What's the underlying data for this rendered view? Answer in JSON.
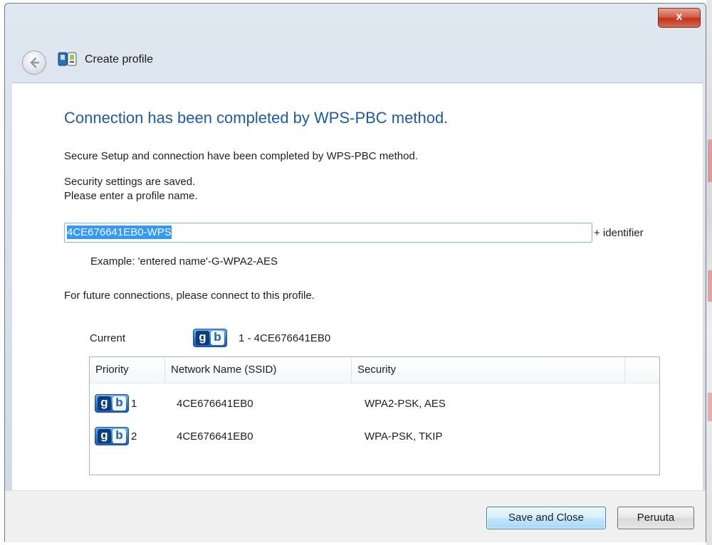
{
  "window": {
    "title": "Create profile",
    "close_label": "x"
  },
  "content": {
    "headline": "Connection has been completed by WPS-PBC method.",
    "line1": "Secure Setup and connection have been completed by WPS-PBC method.",
    "line2": "Security settings are saved.",
    "line3": "Please enter a profile name.",
    "profile_name_value": "4CE676641EB0-WPS",
    "profile_suffix": "+ identifier",
    "example": "Example: 'entered name'-G-WPA2-AES",
    "future_note": "For future connections, please connect to this profile."
  },
  "current": {
    "label": "Current",
    "value": "1 - 4CE676641EB0"
  },
  "table": {
    "headers": [
      "Priority",
      "Network Name (SSID)",
      "Security"
    ],
    "rows": [
      {
        "priority": "1",
        "ssid": "4CE676641EB0",
        "security": "WPA2-PSK, AES"
      },
      {
        "priority": "2",
        "ssid": "4CE676641EB0",
        "security": "WPA-PSK, TKIP"
      }
    ]
  },
  "buttons": {
    "save": "Save and Close",
    "cancel": "Peruuta"
  },
  "icons": {
    "gb_left": "g",
    "gb_right": "b"
  },
  "colors": {
    "headline": "#1d5aa8",
    "selection": "#3399ff",
    "close_button": "#c1341c"
  }
}
